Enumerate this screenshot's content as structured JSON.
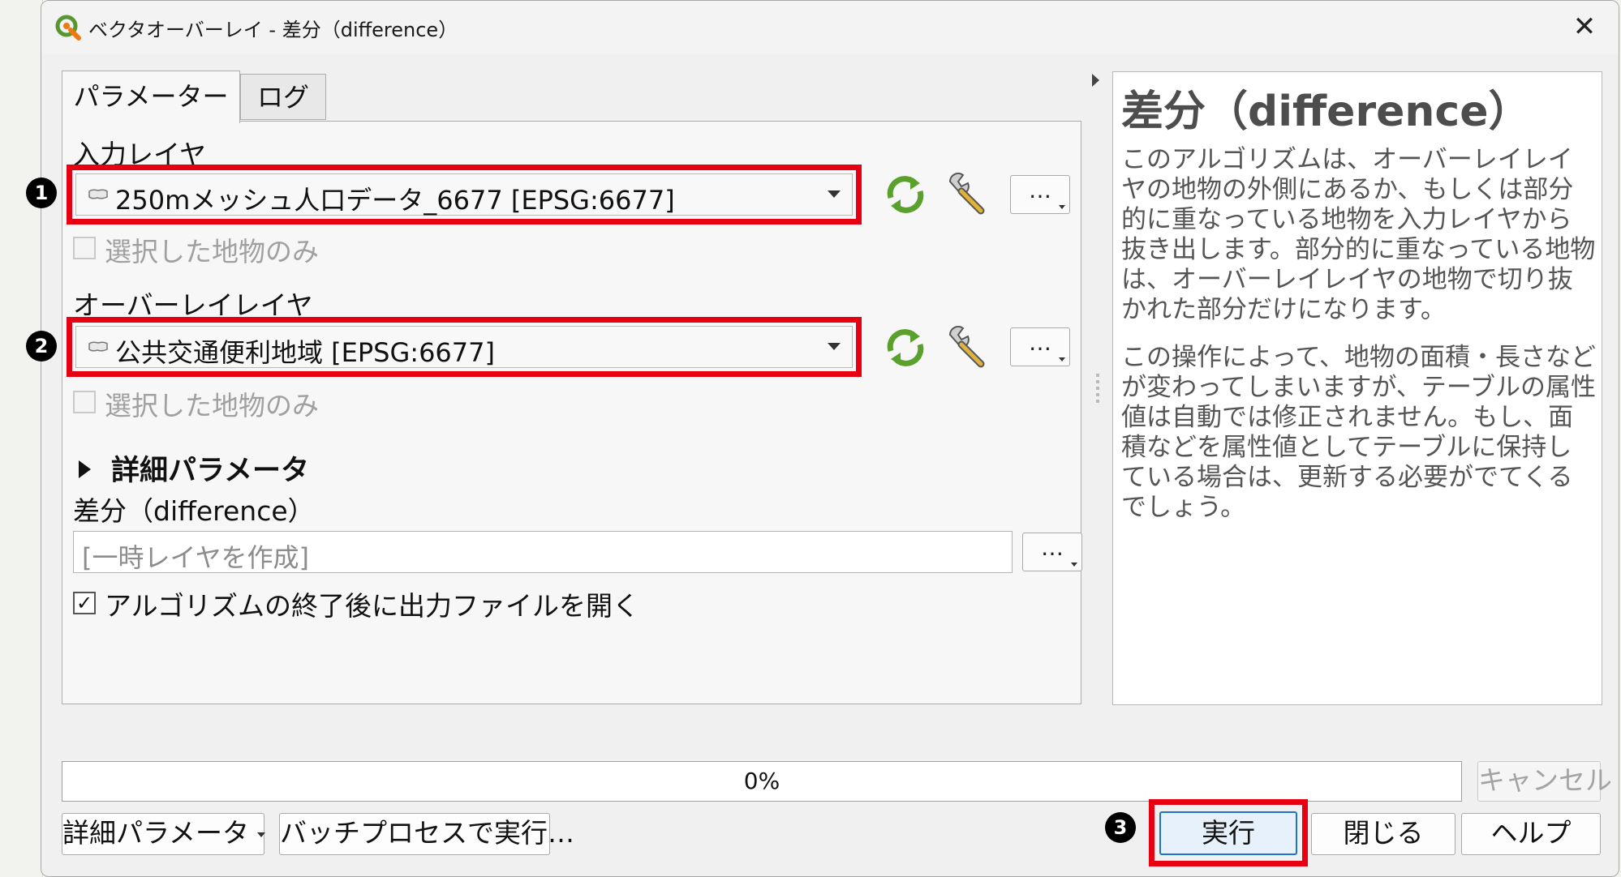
{
  "window": {
    "title": "ベクタオーバーレイ - 差分（difference）",
    "close_glyph": "✕"
  },
  "tabs": [
    {
      "label": "パラメーター",
      "active": true
    },
    {
      "label": "ログ",
      "active": false
    }
  ],
  "params": {
    "input_label": "入力レイヤ",
    "input_value": "250mメッシュ人口データ_6677 [EPSG:6677]",
    "input_selected_only": "選択した地物のみ",
    "overlay_label": "オーバーレイレイヤ",
    "overlay_value": "公共交通便利地域 [EPSG:6677]",
    "overlay_selected_only": "選択した地物のみ",
    "dots": "…",
    "advanced_label": "詳細パラメータ",
    "output_label": "差分（difference）",
    "output_placeholder": "[一時レイヤを作成]",
    "open_output_label": "アルゴリズムの終了後に出力ファイルを開く",
    "open_output_checked": true,
    "check_glyph": "✓"
  },
  "annotations": {
    "badge1": "1",
    "badge2": "2",
    "badge3": "3"
  },
  "help": {
    "title": "差分（difference）",
    "para1": "このアルゴリズムは、オーバーレイレイヤの地物の外側にあるか、もしくは部分的に重なっている地物を入力レイヤから抜き出します。部分的に重なっている地物は、オーバーレイレイヤの地物で切り抜かれた部分だけになります。",
    "para2": "この操作によって、地物の面積・長さなどが変わってしまいますが、テーブルの属性値は自動では修正されません。もし、面積などを属性値としてテーブルに保持している場合は、更新する必要がでてくるでしょう。"
  },
  "progress": {
    "label": "0%",
    "value": 0
  },
  "buttons": {
    "cancel": "キャンセル",
    "advanced": "詳細パラメータ",
    "batch": "バッチプロセスで実行…",
    "run": "実行",
    "close": "閉じる",
    "help": "ヘルプ"
  },
  "icons": {
    "app": "qgis-icon",
    "iterate": "iterate-icon",
    "settings": "wrench-icon",
    "layer": "polygon-layer-icon"
  },
  "colors": {
    "highlight": "#e60012",
    "iterate_icon": "#5aa02c",
    "default_button_border": "#1d74c7"
  }
}
